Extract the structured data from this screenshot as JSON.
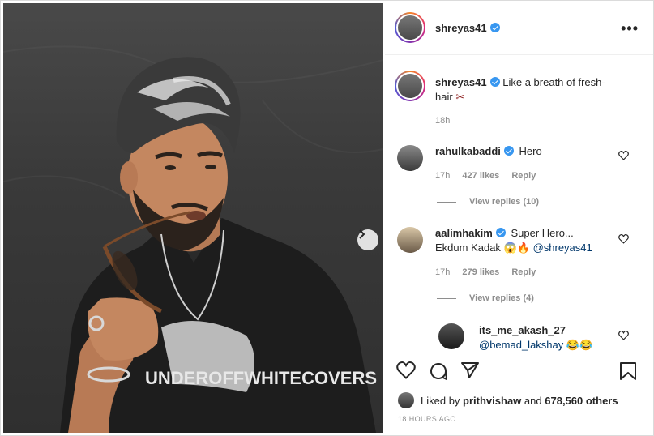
{
  "post": {
    "author": "shreyas41",
    "caption": "Like a breath of fresh-hair",
    "caption_emoji": "✂",
    "caption_age": "18h"
  },
  "comments": [
    {
      "username": "rahulkabaddi",
      "text": "Hero",
      "age": "17h",
      "likes": "427 likes",
      "reply_label": "Reply",
      "view_replies": "View replies (10)"
    },
    {
      "username": "aalimhakim",
      "text_line1": "Super Hero...",
      "text_line2": "Ekdum Kadak",
      "emoji": "😱🔥",
      "mention": "@shreyas41",
      "age": "17h",
      "likes": "279 likes",
      "reply_label": "Reply",
      "view_replies": "View replies (4)"
    }
  ],
  "reply": {
    "username": "its_me_akash_27",
    "mention": "@bemad_lakshay",
    "emoji": "😂😂"
  },
  "likes_summary": {
    "prefix": "Liked by",
    "user": "prithvishaw",
    "joiner": "and",
    "others": "678,560 others"
  },
  "timestamp": "18 HOURS AGO",
  "photo": {
    "shirt_text": "UNDEROFFWHITECOVERS"
  },
  "colors": {
    "verified": "#3897f0",
    "secondary_text": "#8e8e8e",
    "mention": "#00376b"
  }
}
